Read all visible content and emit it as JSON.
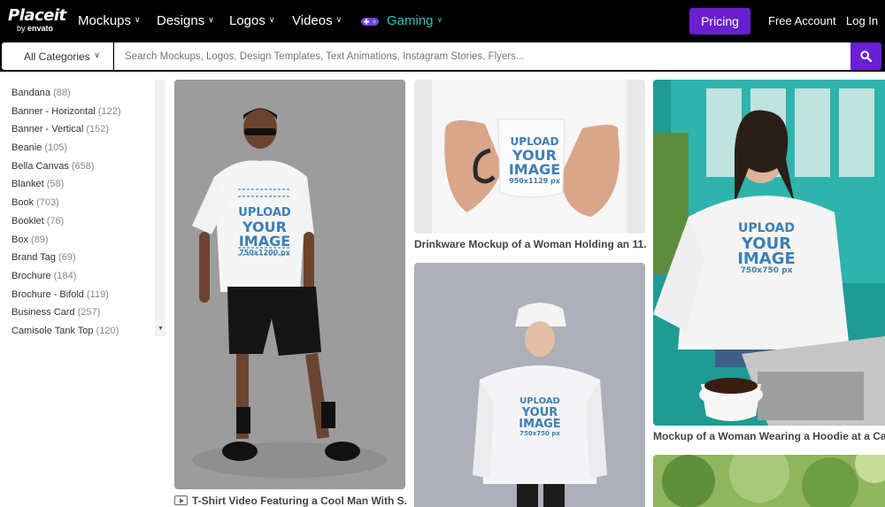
{
  "brand": {
    "name": "Placeit",
    "sub_prefix": "by",
    "sub_brand": "envato"
  },
  "nav": {
    "items": [
      {
        "label": "Mockups"
      },
      {
        "label": "Designs"
      },
      {
        "label": "Logos"
      },
      {
        "label": "Videos"
      },
      {
        "label": "Gaming"
      }
    ],
    "pricing": "Pricing",
    "free_account": "Free Account",
    "login": "Log In"
  },
  "search": {
    "category": "All Categories",
    "placeholder": "Search Mockups, Logos, Design Templates, Text Animations, Instagram Stories, Flyers..."
  },
  "categories": [
    {
      "name": "Bandana",
      "count": "(88)"
    },
    {
      "name": "Banner - Horizontal",
      "count": "(122)"
    },
    {
      "name": "Banner - Vertical",
      "count": "(152)"
    },
    {
      "name": "Beanie",
      "count": "(105)"
    },
    {
      "name": "Bella Canvas",
      "count": "(658)"
    },
    {
      "name": "Blanket",
      "count": "(58)"
    },
    {
      "name": "Book",
      "count": "(703)"
    },
    {
      "name": "Booklet",
      "count": "(76)"
    },
    {
      "name": "Box",
      "count": "(89)"
    },
    {
      "name": "Brand Tag",
      "count": "(69)"
    },
    {
      "name": "Brochure",
      "count": "(184)"
    },
    {
      "name": "Brochure - Bifold",
      "count": "(119)"
    },
    {
      "name": "Business Card",
      "count": "(257)"
    },
    {
      "name": "Camisole Tank Top",
      "count": "(120)"
    }
  ],
  "tiles": [
    {
      "caption": "T-Shirt Video Featuring a Cool Man With S...",
      "upload_line1": "UPLOAD",
      "upload_line2": "YOUR",
      "upload_line3": "IMAGE",
      "dims": "750x1200 px"
    },
    {
      "caption": "Drinkware Mockup of a Woman Holding an 11...",
      "upload_line1": "UPLOAD",
      "upload_line2": "YOUR",
      "upload_line3": "IMAGE",
      "dims": "950x1129 px"
    },
    {
      "caption": "Mockup of a Woman Wearing a Hoodie at a Cafe",
      "upload_line1": "UPLOAD",
      "upload_line2": "YOUR",
      "upload_line3": "IMAGE",
      "dims": "750x750 px"
    },
    {
      "caption": "",
      "upload_line1": "UPLOAD",
      "upload_line2": "YOUR",
      "upload_line3": "IMAGE",
      "dims": "750x750 px"
    }
  ],
  "colors": {
    "accent": "#6a1fd0",
    "gaming": "#2ec4b6",
    "nav_bg": "#000000"
  }
}
